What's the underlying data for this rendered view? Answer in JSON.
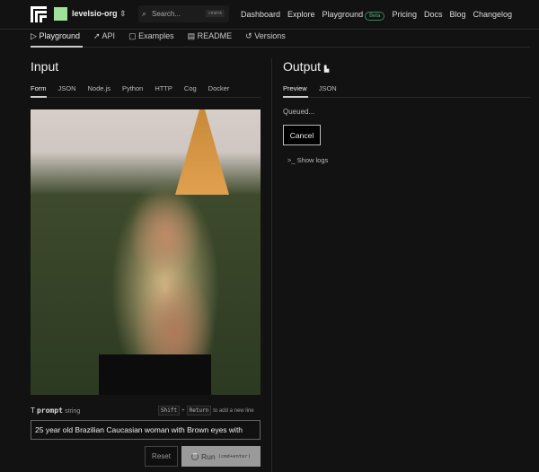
{
  "header": {
    "org": "levelsio-org",
    "search_placeholder": "Search...",
    "search_shortcut": "cmd+k",
    "nav": [
      "Dashboard",
      "Explore",
      "Playground",
      "Pricing",
      "Docs",
      "Blog",
      "Changelog"
    ],
    "beta": "Beta"
  },
  "tabs": [
    "Playground",
    "API",
    "Examples",
    "README",
    "Versions"
  ],
  "input": {
    "title": "Input",
    "tabs": [
      "Form",
      "JSON",
      "Node.js",
      "Python",
      "HTTP",
      "Cog",
      "Docker"
    ],
    "field_name": "prompt",
    "field_type": "string",
    "hint_key1": "Shift",
    "hint_plus": "+",
    "hint_key2": "Return",
    "hint_text": "to add a new line",
    "prompt_value": "25 year old Brazilian Caucasian woman with Brown eyes with",
    "reset": "Reset",
    "run": "Run",
    "run_shortcut": "(cmd+enter)"
  },
  "output": {
    "title": "Output",
    "tabs": [
      "Preview",
      "JSON"
    ],
    "status": "Queued...",
    "cancel": "Cancel",
    "show_logs": "Show logs"
  }
}
